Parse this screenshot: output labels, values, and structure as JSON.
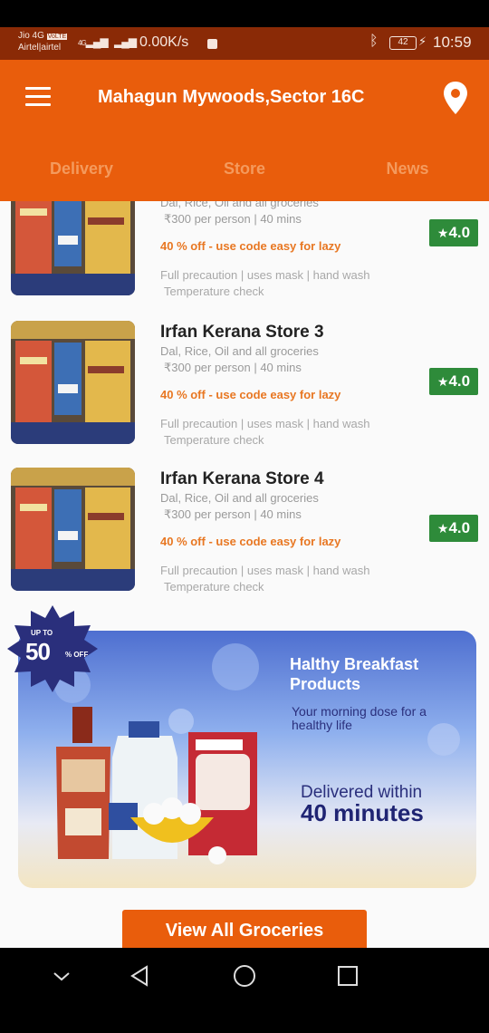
{
  "status_bar": {
    "carrier1": "Jio 4G",
    "volte": "VoLTE",
    "carrier2": "Airtel|airtel",
    "net": "4G",
    "speed": "0.00K/s",
    "battery": "42",
    "time": "10:59"
  },
  "header": {
    "location": "Mahagun Mywoods,Sector 16C",
    "tabs": [
      "Delivery",
      "Store",
      "News"
    ]
  },
  "stores": [
    {
      "name": "",
      "desc": "Dal, Rice, Oil and all groceries",
      "price": "₹300 per person | 40 mins",
      "offer": "40 % off - use code easy for lazy",
      "precaution": "Full precaution | uses mask | hand wash",
      "precaution2": "Temperature check",
      "rating": "4.0"
    },
    {
      "name": "Irfan Kerana Store 3",
      "desc": "Dal, Rice, Oil and all groceries",
      "price": "₹300 per person | 40 mins",
      "offer": "40 % off - use code easy for lazy",
      "precaution": "Full precaution | uses mask | hand wash",
      "precaution2": "Temperature check",
      "rating": "4.0"
    },
    {
      "name": "Irfan Kerana Store 4",
      "desc": "Dal, Rice, Oil and all groceries",
      "price": "₹300 per person | 40 mins",
      "offer": "40 % off - use code easy for lazy",
      "precaution": "Full precaution | uses mask | hand wash",
      "precaution2": "Temperature check",
      "rating": "4.0"
    }
  ],
  "banner": {
    "badge_top": "UP TO",
    "badge_value": "50",
    "badge_unit": "% OFF",
    "heading": "Halthy Breakfast Products",
    "subtitle": "Your morning dose for a healthy life",
    "delivery_line1": "Delivered within",
    "delivery_line2": "40 minutes"
  },
  "cta": {
    "label": "View All Groceries"
  },
  "colors": {
    "primary": "#e95d0c",
    "status_bar": "#8a2a06",
    "rating_green": "#2e8b3a",
    "offer_orange": "#e87722"
  },
  "icons": {
    "menu": "hamburger-icon",
    "location": "location-pin-icon",
    "rating": "star-icon",
    "nav_back": "triangle-back-icon",
    "nav_home": "circle-home-icon",
    "nav_recent": "square-recent-icon",
    "nav_down": "chevron-down-icon"
  }
}
